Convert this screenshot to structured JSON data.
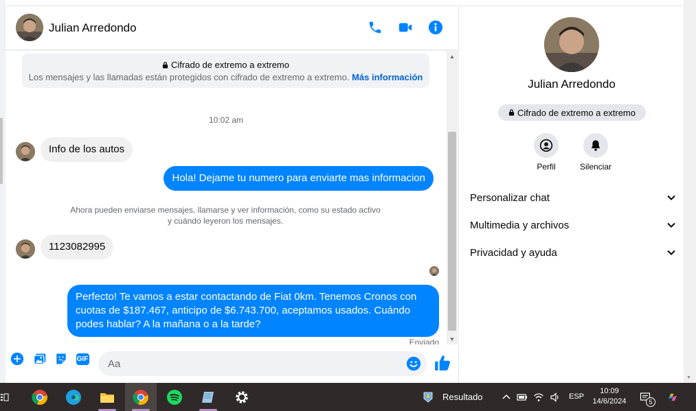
{
  "contact": {
    "name": "Julian Arredondo"
  },
  "header": {
    "call_icon": "phone-icon",
    "video_icon": "video-icon",
    "info_icon": "info-icon"
  },
  "encryption": {
    "title": "Cifrado de extremo a extremo",
    "description": "Los mensajes y las llamadas están protegidos con cifrado de extremo a extremo.",
    "link": "Más información"
  },
  "conversation": {
    "time_label": "10:02 am",
    "messages": [
      {
        "direction": "in",
        "text": "Info de los autos"
      },
      {
        "direction": "out",
        "text": "Hola! Dejame tu numero para enviarte mas informacion"
      },
      {
        "direction": "in",
        "text": "1123082995"
      },
      {
        "direction": "out",
        "text": "Perfecto! Te vamos a estar contactando de Fiat 0km. Tenemos Cronos con cuotas de $187.467, anticipo de $6.743.700, aceptamos usados. Cuándo podes hablar? A la mañana o a la tarde?"
      }
    ],
    "system_note": "Ahora pueden enviarse mensajes, llamarse y ver información, como su estado activo y cuándo leyeron los mensajes.",
    "sent_status": "Enviado"
  },
  "composer": {
    "placeholder": "Aa",
    "gif_label": "GIF"
  },
  "info_panel": {
    "e2e_pill": "Cifrado de extremo a extremo",
    "actions": [
      {
        "label": "Perfil",
        "icon": "profile-icon"
      },
      {
        "label": "Silenciar",
        "icon": "bell-icon"
      }
    ],
    "sections": [
      {
        "label": "Personalizar chat"
      },
      {
        "label": "Multimedia y archivos"
      },
      {
        "label": "Privacidad y ayuda"
      }
    ]
  },
  "taskbar": {
    "weather_text": "Resultado",
    "language": "ESP",
    "time": "10:09",
    "date": "14/6/2024",
    "notification_count": "5"
  },
  "colors": {
    "accent": "#0084ff",
    "incoming_bubble": "#f0f0f0",
    "taskbar": "#2f2a29"
  }
}
